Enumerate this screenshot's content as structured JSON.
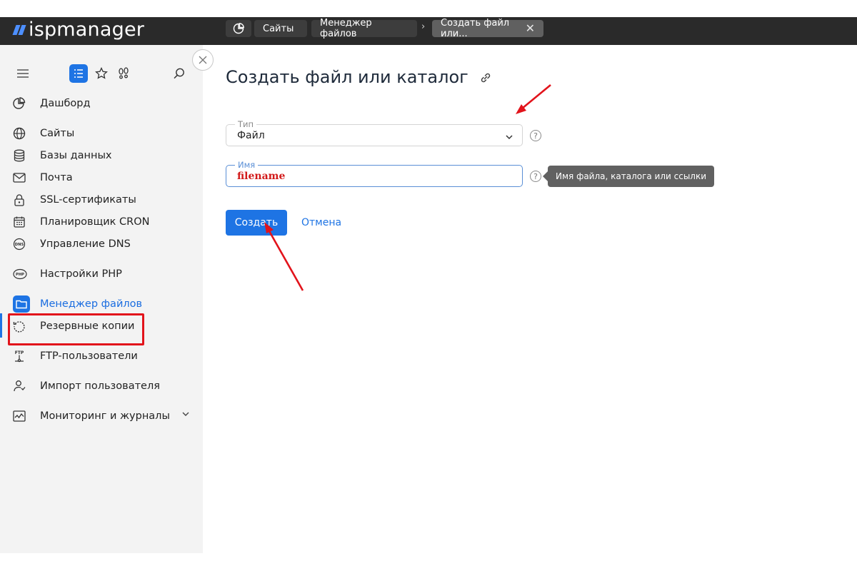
{
  "app": {
    "logo_text": "ispmanager",
    "brand_color": "#1e74e4",
    "annotation_color": "#e2131b"
  },
  "breadcrumbs": [
    {
      "icon": "dashboard-icon"
    },
    {
      "label": "Сайты"
    },
    {
      "label": "Менеджер файлов"
    },
    {
      "label": "Создать файл или..."
    }
  ],
  "sidebar": {
    "toolbar_icons": [
      "menu-icon",
      "list-icon",
      "star-icon",
      "footprints-icon",
      "search-icon"
    ],
    "items": [
      {
        "label": "Дашборд",
        "icon": "pie-chart-icon"
      },
      {
        "label": "Сайты",
        "icon": "globe-icon"
      },
      {
        "label": "Базы данных",
        "icon": "database-icon"
      },
      {
        "label": "Почта",
        "icon": "mail-icon"
      },
      {
        "label": "SSL-сертификаты",
        "icon": "lock-icon"
      },
      {
        "label": "Планировщик CRON",
        "icon": "calendar-icon"
      },
      {
        "label": "Управление DNS",
        "icon": "dns-icon",
        "icon_text": "DNS"
      },
      {
        "label": "Настройки PHP",
        "icon": "php-icon",
        "icon_text": "PHP"
      },
      {
        "label": "Менеджер файлов",
        "icon": "folder-icon",
        "active": true
      },
      {
        "label": "Резервные копии",
        "icon": "backup-icon"
      },
      {
        "label": "FTP-пользователи",
        "icon": "ftp-icon",
        "icon_text": "FTP"
      },
      {
        "label": "Импорт пользователя",
        "icon": "user-import-icon"
      },
      {
        "label": "Мониторинг и журналы",
        "icon": "monitor-icon"
      }
    ]
  },
  "form": {
    "title": "Создать файл или каталог",
    "type": {
      "label": "Тип",
      "value": "Файл"
    },
    "name": {
      "label": "Имя",
      "value": "filename"
    },
    "tooltip": "Имя файла, каталога или ссылки",
    "help_glyph": "?",
    "submit_label": "Создать",
    "cancel_label": "Отмена"
  }
}
